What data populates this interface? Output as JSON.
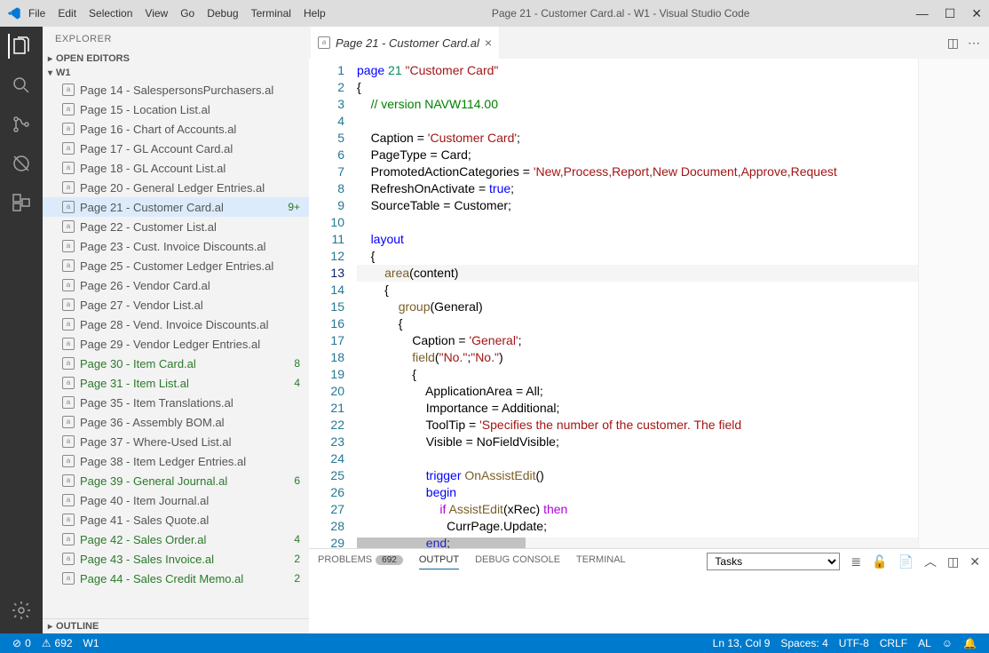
{
  "titlebar": {
    "menus": [
      "File",
      "Edit",
      "Selection",
      "View",
      "Go",
      "Debug",
      "Terminal",
      "Help"
    ],
    "title": "Page 21 - Customer Card.al - W1 - Visual Studio Code"
  },
  "sidebar": {
    "title": "EXPLORER",
    "sections": {
      "open_editors": "OPEN EDITORS",
      "workspace": "W1",
      "outline": "OUTLINE"
    },
    "files": [
      {
        "name": "Page 14 - SalespersonsPurchasers.al",
        "modified": false,
        "badge": ""
      },
      {
        "name": "Page 15 - Location List.al",
        "modified": false,
        "badge": ""
      },
      {
        "name": "Page 16 - Chart of Accounts.al",
        "modified": false,
        "badge": ""
      },
      {
        "name": "Page 17 - GL Account Card.al",
        "modified": false,
        "badge": ""
      },
      {
        "name": "Page 18 - GL Account List.al",
        "modified": false,
        "badge": ""
      },
      {
        "name": "Page 20 - General Ledger Entries.al",
        "modified": false,
        "badge": ""
      },
      {
        "name": "Page 21 - Customer Card.al",
        "modified": false,
        "badge": "9+",
        "active": true
      },
      {
        "name": "Page 22 - Customer List.al",
        "modified": false,
        "badge": ""
      },
      {
        "name": "Page 23 - Cust. Invoice Discounts.al",
        "modified": false,
        "badge": ""
      },
      {
        "name": "Page 25 - Customer Ledger Entries.al",
        "modified": false,
        "badge": ""
      },
      {
        "name": "Page 26 - Vendor Card.al",
        "modified": false,
        "badge": ""
      },
      {
        "name": "Page 27 - Vendor List.al",
        "modified": false,
        "badge": ""
      },
      {
        "name": "Page 28 - Vend. Invoice Discounts.al",
        "modified": false,
        "badge": ""
      },
      {
        "name": "Page 29 - Vendor Ledger Entries.al",
        "modified": false,
        "badge": ""
      },
      {
        "name": "Page 30 - Item Card.al",
        "modified": true,
        "badge": "8"
      },
      {
        "name": "Page 31 - Item List.al",
        "modified": true,
        "badge": "4"
      },
      {
        "name": "Page 35 - Item Translations.al",
        "modified": false,
        "badge": ""
      },
      {
        "name": "Page 36 - Assembly BOM.al",
        "modified": false,
        "badge": ""
      },
      {
        "name": "Page 37 - Where-Used List.al",
        "modified": false,
        "badge": ""
      },
      {
        "name": "Page 38 - Item Ledger Entries.al",
        "modified": false,
        "badge": ""
      },
      {
        "name": "Page 39 - General Journal.al",
        "modified": true,
        "badge": "6"
      },
      {
        "name": "Page 40 - Item Journal.al",
        "modified": false,
        "badge": ""
      },
      {
        "name": "Page 41 - Sales Quote.al",
        "modified": false,
        "badge": ""
      },
      {
        "name": "Page 42 - Sales Order.al",
        "modified": true,
        "badge": "4"
      },
      {
        "name": "Page 43 - Sales Invoice.al",
        "modified": true,
        "badge": "2"
      },
      {
        "name": "Page 44 - Sales Credit Memo.al",
        "modified": true,
        "badge": "2"
      }
    ]
  },
  "tab": {
    "label": "Page 21 - Customer Card.al"
  },
  "code": {
    "lines": [
      [
        [
          "kw",
          "page"
        ],
        [
          "sp",
          " "
        ],
        [
          "num",
          "21"
        ],
        [
          "sp",
          " "
        ],
        [
          "str",
          "\"Customer Card\""
        ]
      ],
      [
        [
          "id",
          "{"
        ]
      ],
      [
        [
          "sp",
          "    "
        ],
        [
          "comment",
          "// version NAVW114.00"
        ]
      ],
      [
        [
          "sp",
          " "
        ]
      ],
      [
        [
          "sp",
          "    "
        ],
        [
          "id",
          "Caption = "
        ],
        [
          "str",
          "'Customer Card'"
        ],
        [
          "id",
          ";"
        ]
      ],
      [
        [
          "sp",
          "    "
        ],
        [
          "id",
          "PageType = Card;"
        ]
      ],
      [
        [
          "sp",
          "    "
        ],
        [
          "id",
          "PromotedActionCategories = "
        ],
        [
          "str",
          "'New,Process,Report,New Document,Approve,Request"
        ]
      ],
      [
        [
          "sp",
          "    "
        ],
        [
          "id",
          "RefreshOnActivate = "
        ],
        [
          "kw",
          "true"
        ],
        [
          "id",
          ";"
        ]
      ],
      [
        [
          "sp",
          "    "
        ],
        [
          "id",
          "SourceTable = Customer;"
        ]
      ],
      [
        [
          "sp",
          " "
        ]
      ],
      [
        [
          "sp",
          "    "
        ],
        [
          "kw",
          "layout"
        ]
      ],
      [
        [
          "sp",
          "    "
        ],
        [
          "id",
          "{"
        ]
      ],
      [
        [
          "sp",
          "        "
        ],
        [
          "fn",
          "area"
        ],
        [
          "id",
          "(content)"
        ]
      ],
      [
        [
          "sp",
          "        "
        ],
        [
          "id",
          "{"
        ]
      ],
      [
        [
          "sp",
          "            "
        ],
        [
          "fn",
          "group"
        ],
        [
          "id",
          "(General)"
        ]
      ],
      [
        [
          "sp",
          "            "
        ],
        [
          "id",
          "{"
        ]
      ],
      [
        [
          "sp",
          "                "
        ],
        [
          "id",
          "Caption = "
        ],
        [
          "str",
          "'General'"
        ],
        [
          "id",
          ";"
        ]
      ],
      [
        [
          "sp",
          "                "
        ],
        [
          "fn",
          "field"
        ],
        [
          "id",
          "("
        ],
        [
          "str",
          "\"No.\""
        ],
        [
          "id",
          ";"
        ],
        [
          "str",
          "\"No.\""
        ],
        [
          "id",
          ")"
        ]
      ],
      [
        [
          "sp",
          "                "
        ],
        [
          "id",
          "{"
        ]
      ],
      [
        [
          "sp",
          "                    "
        ],
        [
          "id",
          "ApplicationArea = All;"
        ]
      ],
      [
        [
          "sp",
          "                    "
        ],
        [
          "id",
          "Importance = Additional;"
        ]
      ],
      [
        [
          "sp",
          "                    "
        ],
        [
          "id",
          "ToolTip = "
        ],
        [
          "str",
          "'Specifies the number of the customer. The field"
        ]
      ],
      [
        [
          "sp",
          "                    "
        ],
        [
          "id",
          "Visible = NoFieldVisible;"
        ]
      ],
      [
        [
          "sp",
          " "
        ]
      ],
      [
        [
          "sp",
          "                    "
        ],
        [
          "kw",
          "trigger"
        ],
        [
          "sp",
          " "
        ],
        [
          "fn",
          "OnAssistEdit"
        ],
        [
          "id",
          "()"
        ]
      ],
      [
        [
          "sp",
          "                    "
        ],
        [
          "kw",
          "begin"
        ]
      ],
      [
        [
          "sp",
          "                        "
        ],
        [
          "ctrl",
          "if"
        ],
        [
          "sp",
          " "
        ],
        [
          "fn",
          "AssistEdit"
        ],
        [
          "id",
          "(xRec) "
        ],
        [
          "ctrl",
          "then"
        ]
      ],
      [
        [
          "sp",
          "                          "
        ],
        [
          "id",
          "CurrPage.Update;"
        ]
      ],
      [
        [
          "sp",
          "                    "
        ],
        [
          "kw",
          "end"
        ],
        [
          "id",
          ";"
        ]
      ],
      [
        [
          "sp",
          "                "
        ],
        [
          "id",
          "}"
        ]
      ]
    ],
    "current_line": 13
  },
  "panel": {
    "tabs": {
      "problems": "PROBLEMS",
      "problems_count": "692",
      "output": "OUTPUT",
      "debug": "DEBUG CONSOLE",
      "terminal": "TERMINAL"
    },
    "selector": "Tasks"
  },
  "statusbar": {
    "errors": "0",
    "warnings": "692",
    "branch": "W1",
    "position": "Ln 13, Col 9",
    "spaces": "Spaces: 4",
    "encoding": "UTF-8",
    "eol": "CRLF",
    "lang": "AL"
  }
}
